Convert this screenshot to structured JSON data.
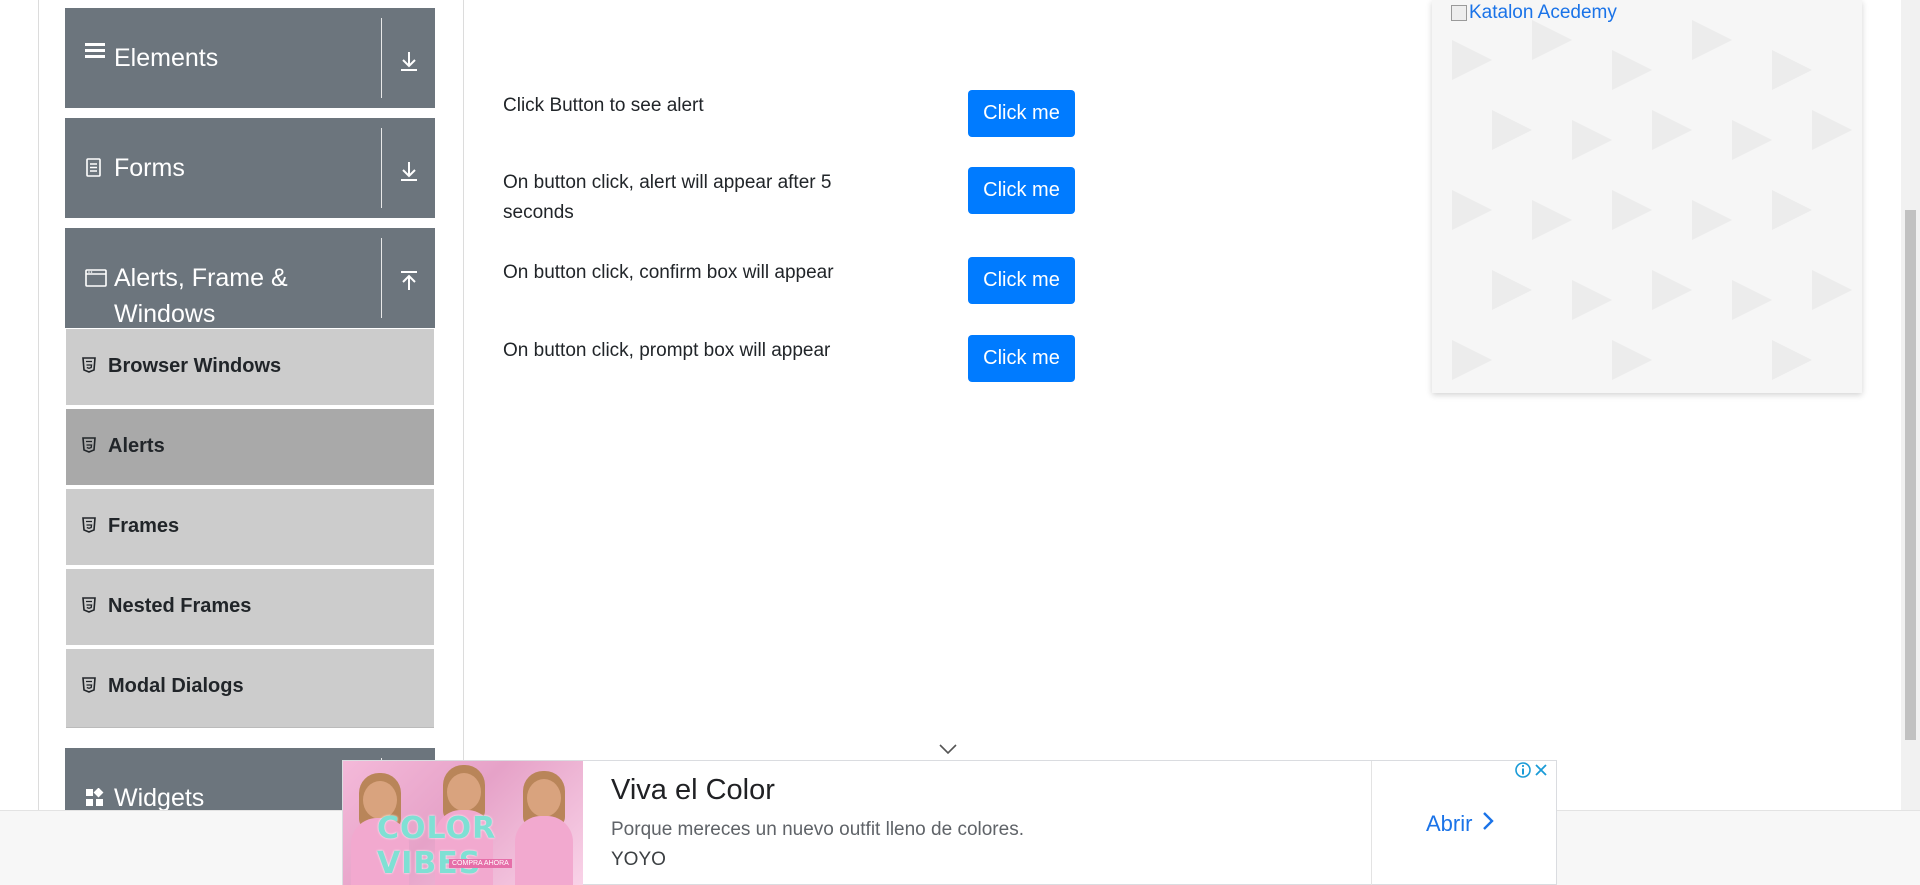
{
  "sidebar": {
    "groups": [
      {
        "label": "Elements",
        "icon": "hamburger-icon",
        "toggle_icon": "download-arrow-icon"
      },
      {
        "label": "Forms",
        "icon": "document-icon",
        "toggle_icon": "download-arrow-icon"
      },
      {
        "label": "Alerts, Frame & Windows",
        "icon": "window-icon",
        "toggle_icon": "upload-arrow-icon"
      },
      {
        "label": "Widgets",
        "icon": "grid-icon"
      }
    ],
    "items": [
      {
        "label": "Browser Windows",
        "active": false
      },
      {
        "label": "Alerts",
        "active": true
      },
      {
        "label": "Frames",
        "active": false
      },
      {
        "label": "Nested Frames",
        "active": false
      },
      {
        "label": "Modal Dialogs",
        "active": false
      }
    ]
  },
  "alerts": {
    "rows": [
      {
        "text": "Click Button to see alert",
        "button": "Click me"
      },
      {
        "text": "On button click, alert will appear after 5 seconds",
        "button": "Click me"
      },
      {
        "text": "On button click, confirm box will appear",
        "button": "Click me"
      },
      {
        "text": "On button click, prompt box will appear",
        "button": "Click me"
      }
    ]
  },
  "right_ad": {
    "alt_text": "Katalon Acedemy"
  },
  "bottom_ad": {
    "image_text": "COLOR VIBES",
    "image_subtext": "COMPRA AHORA",
    "title": "Viva el Color",
    "description": "Porque mereces un nuevo outfit lleno de colores.",
    "brand": "YOYO",
    "cta": "Abrir"
  },
  "colors": {
    "sidebar_header": "#6c757d",
    "sidebar_item": "#cccccc",
    "sidebar_item_active": "#a9a9a9",
    "primary_button": "#007bff",
    "ad_link": "#1a73e8"
  }
}
